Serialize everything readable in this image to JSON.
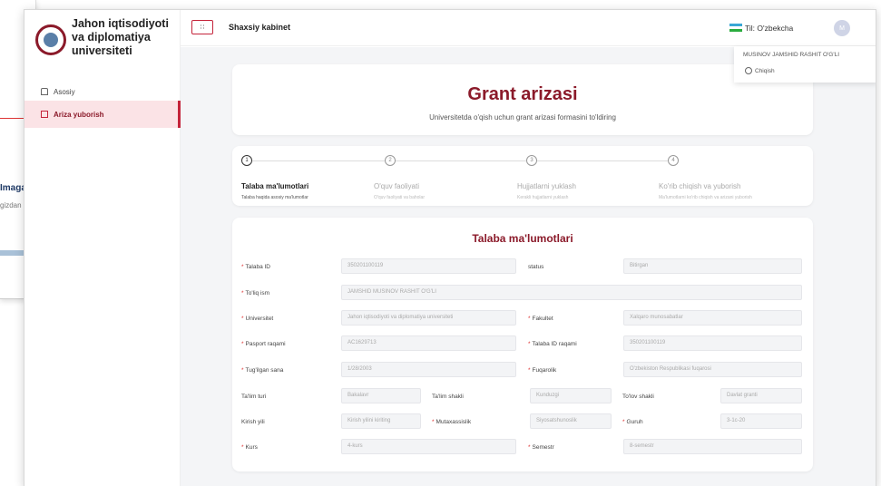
{
  "background": {
    "fragment_title": "Imaga",
    "fragment_text": "gizdan"
  },
  "sidebar": {
    "university_name": "Jahon iqtisodiyoti va diplomatiya universiteti",
    "items": [
      {
        "label": "Asosiy"
      },
      {
        "label": "Ariza yuborish"
      }
    ]
  },
  "topbar": {
    "menu_glyph": "∷",
    "page_name": "Shaxsiy kabinet",
    "language": "Til: O'zbekcha",
    "avatar_initial": "M"
  },
  "dropdown": {
    "user_name": "MUSINOV JAMSHID RASHIT O'G'LI",
    "logout": "Chiqish"
  },
  "header": {
    "title": "Grant arizasi",
    "subtitle": "Universitetda o'qish uchun grant arizasi formasini to'ldiring"
  },
  "steps": [
    {
      "num": "1",
      "title": "Talaba ma'lumotlari",
      "desc": "Talaba haqida asosiy ma'lumotlar"
    },
    {
      "num": "2",
      "title": "O'quv faoliyati",
      "desc": "O'quv faoliyati va baholar"
    },
    {
      "num": "3",
      "title": "Hujjatlarni yuklash",
      "desc": "Kerakli hujjatlarni yuklash"
    },
    {
      "num": "4",
      "title": "Ko'rib chiqish va yuborish",
      "desc": "Ma'lumotlarni ko'rib chiqish va arizani yuborish"
    }
  ],
  "form": {
    "title": "Talaba ma'lumotlari",
    "fields": {
      "talaba_id": {
        "label": "Talaba ID",
        "value": "350201100119"
      },
      "status": {
        "label": "status",
        "value": "Bitirgan"
      },
      "full_name": {
        "label": "To'liq ism",
        "value": "JAMSHID MUSINOV RASHIT O'G'LI"
      },
      "university": {
        "label": "Universitet",
        "value": "Jahon iqtisodiyoti va diplomatiya universiteti"
      },
      "faculty": {
        "label": "Fakultet",
        "value": "Xalqaro munosabatlar"
      },
      "passport": {
        "label": "Pasport raqami",
        "value": "AC1629713"
      },
      "student_id_num": {
        "label": "Talaba ID raqami",
        "value": "350201100119"
      },
      "birth_date": {
        "label": "Tug'ilgan sana",
        "value": "1/28/2003"
      },
      "citizenship": {
        "label": "Fuqarolik",
        "value": "O'zbekiston Respublikasi fuqarosi"
      },
      "edu_type": {
        "label": "Ta'lim turi",
        "value": "Bakalavr"
      },
      "edu_form": {
        "label": "Ta'lim shakli",
        "value": "Kunduzgi"
      },
      "pay_form": {
        "label": "To'lov shakli",
        "value": "Davlat granti"
      },
      "entry_year": {
        "label": "Kirish yili",
        "placeholder": "Kirish yilini kiriting"
      },
      "specialty": {
        "label": "Mutaxassislik",
        "value": "Siyosatshunoslik"
      },
      "group": {
        "label": "Guruh",
        "value": "3-1c-20"
      },
      "course": {
        "label": "Kurs",
        "value": "4-kurs"
      },
      "semester": {
        "label": "Semestr",
        "value": "8-semestr"
      }
    }
  }
}
